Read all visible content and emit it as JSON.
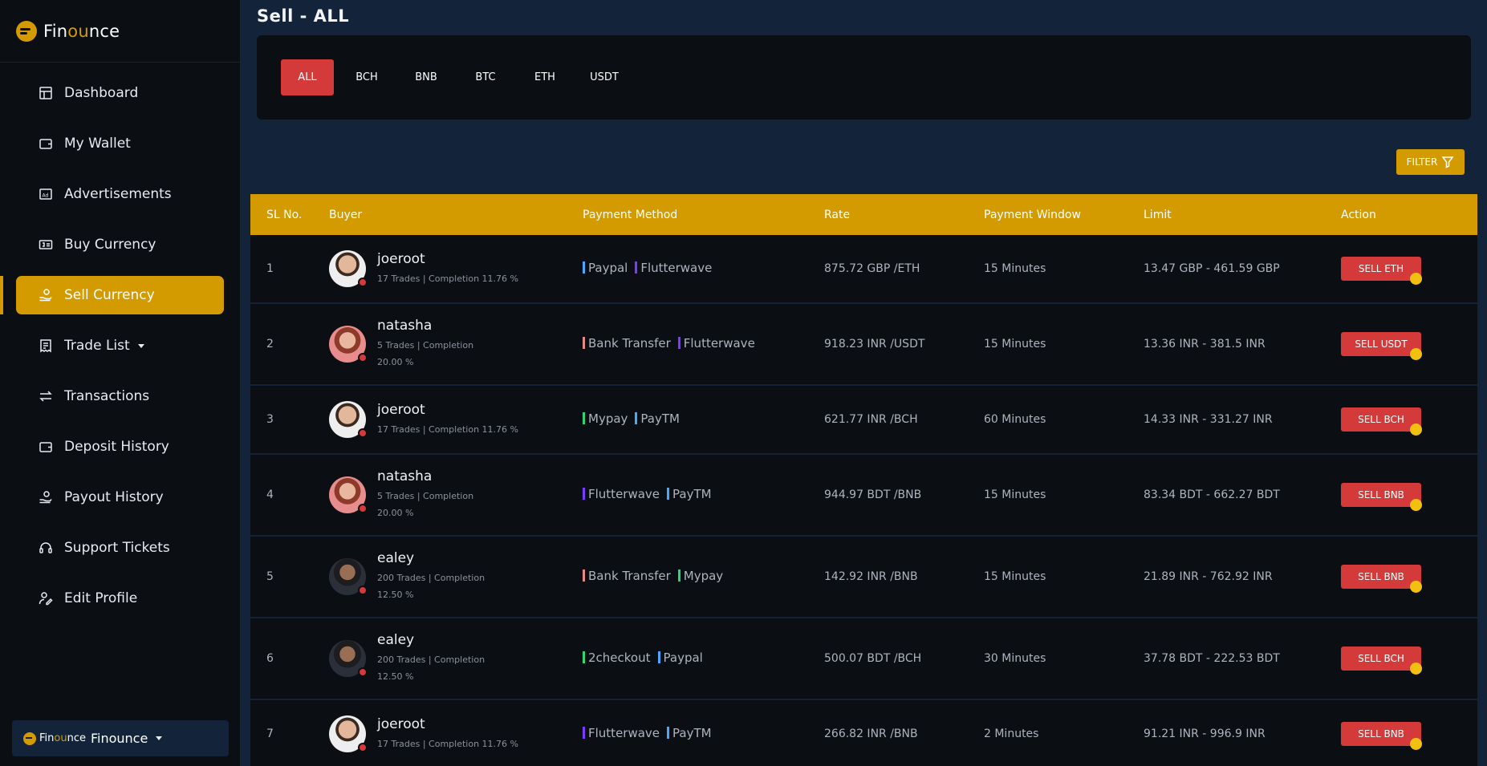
{
  "brand": {
    "name_left": "Fin",
    "name_hl": "ou",
    "name_right": "nce"
  },
  "sidebar": {
    "items": [
      {
        "label": "Dashboard",
        "icon": "dashboard-icon"
      },
      {
        "label": "My Wallet",
        "icon": "wallet-icon"
      },
      {
        "label": "Advertisements",
        "icon": "ad-icon"
      },
      {
        "label": "Buy Currency",
        "icon": "money-icon"
      },
      {
        "label": "Sell Currency",
        "icon": "hand-coin-icon",
        "active": true
      },
      {
        "label": "Trade List",
        "icon": "receipt-icon",
        "dropdown": true
      },
      {
        "label": "Transactions",
        "icon": "transfer-icon"
      },
      {
        "label": "Deposit History",
        "icon": "wallet-icon"
      },
      {
        "label": "Payout History",
        "icon": "hand-coin-icon"
      },
      {
        "label": "Support Tickets",
        "icon": "headset-icon"
      },
      {
        "label": "Edit Profile",
        "icon": "user-edit-icon"
      }
    ],
    "account": {
      "label": "Finounce"
    }
  },
  "page": {
    "title": "Sell - ALL",
    "tabs": [
      "ALL",
      "BCH",
      "BNB",
      "BTC",
      "ETH",
      "USDT"
    ],
    "active_tab": "ALL",
    "filter_label": "FILTER"
  },
  "table": {
    "headers": [
      "SL No.",
      "Buyer",
      "Payment Method",
      "Rate",
      "Payment Window",
      "Limit",
      "Action"
    ],
    "rows": [
      {
        "sl": "1",
        "buyer": "joeroot",
        "stats": "17 Trades | Completion 11.76 %",
        "avatar": "joe",
        "methods": [
          {
            "name": "Paypal",
            "color": "#4aa8ff"
          },
          {
            "name": "Flutterwave",
            "color": "#7a3cff"
          }
        ],
        "rate": "875.72 GBP /ETH",
        "window": "15 Minutes",
        "limit": "13.47 GBP - 461.59 GBP",
        "action": "SELL ETH",
        "height": 86
      },
      {
        "sl": "2",
        "buyer": "natasha",
        "stats": "5 Trades | Completion 20.00 %",
        "avatar": "nat",
        "methods": [
          {
            "name": "Bank Transfer",
            "color": "#e58a8a"
          },
          {
            "name": "Flutterwave",
            "color": "#7a3cff"
          }
        ],
        "rate": "918.23 INR /USDT",
        "window": "15 Minutes",
        "limit": "13.36 INR - 381.5 INR",
        "action": "SELL USDT",
        "height": 102
      },
      {
        "sl": "3",
        "buyer": "joeroot",
        "stats": "17 Trades | Completion 11.76 %",
        "avatar": "joe",
        "methods": [
          {
            "name": "Mypay",
            "color": "#2ed47a"
          },
          {
            "name": "PayTM",
            "color": "#4aa8ff"
          }
        ],
        "rate": "621.77 INR /BCH",
        "window": "60 Minutes",
        "limit": "14.33 INR - 331.27 INR",
        "action": "SELL BCH",
        "height": 86
      },
      {
        "sl": "4",
        "buyer": "natasha",
        "stats": "5 Trades | Completion 20.00 %",
        "avatar": "nat",
        "methods": [
          {
            "name": "Flutterwave",
            "color": "#7a3cff"
          },
          {
            "name": "PayTM",
            "color": "#4aa8ff"
          }
        ],
        "rate": "944.97 BDT /BNB",
        "window": "15 Minutes",
        "limit": "83.34 BDT - 662.27 BDT",
        "action": "SELL BNB",
        "height": 102
      },
      {
        "sl": "5",
        "buyer": "ealey",
        "stats": "200 Trades | Completion 12.50 %",
        "avatar": "eal",
        "methods": [
          {
            "name": "Bank Transfer",
            "color": "#e58a8a"
          },
          {
            "name": "Mypay",
            "color": "#2ed47a"
          }
        ],
        "rate": "142.92 INR /BNB",
        "window": "15 Minutes",
        "limit": "21.89 INR - 762.92 INR",
        "action": "SELL BNB",
        "height": 102
      },
      {
        "sl": "6",
        "buyer": "ealey",
        "stats": "200 Trades | Completion 12.50 %",
        "avatar": "eal",
        "methods": [
          {
            "name": "2checkout",
            "color": "#2ed47a"
          },
          {
            "name": "Paypal",
            "color": "#4aa8ff"
          }
        ],
        "rate": "500.07 BDT /BCH",
        "window": "30 Minutes",
        "limit": "37.78 BDT - 222.53 BDT",
        "action": "SELL BCH",
        "height": 102
      },
      {
        "sl": "7",
        "buyer": "joeroot",
        "stats": "17 Trades | Completion 11.76 %",
        "avatar": "joe",
        "methods": [
          {
            "name": "Flutterwave",
            "color": "#7a3cff"
          },
          {
            "name": "PayTM",
            "color": "#4aa8ff"
          }
        ],
        "rate": "266.82 INR /BNB",
        "window": "2 Minutes",
        "limit": "91.21 INR - 996.9 INR",
        "action": "SELL BNB",
        "height": 86
      }
    ]
  }
}
